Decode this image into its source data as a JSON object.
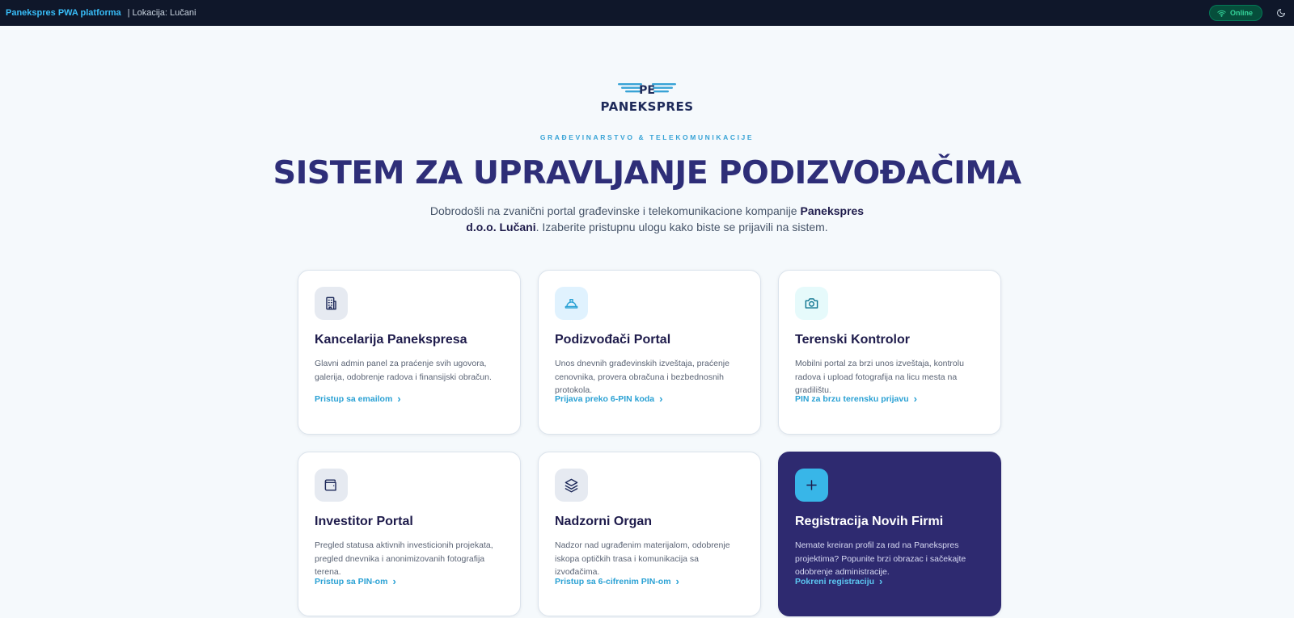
{
  "topbar": {
    "brand": "Panekspres PWA platforma",
    "location": "| Lokacija: Lučani",
    "status": "Online",
    "status_color": "#34d399"
  },
  "hero": {
    "logo_text": "PANEKSPRES",
    "tagline": "GRAĐEVINARSTVO & TELEKOMUNIKACIJE",
    "title": "SISTEM ZA UPRAVLJANJE PODIZVOĐAČIMA",
    "intro_pre": "Dobrodošli na zvanični portal građevinske i telekomunikacione kompanije ",
    "intro_bold": "Panekspres d.o.o. Lučani",
    "intro_post": ". Izaberite pristupnu ulogu kako biste se prijavili na sistem."
  },
  "cards": [
    {
      "icon": "building-icon",
      "title": "Kancelarija Panekspresa",
      "description": "Glavni admin panel za praćenje svih ugovora, galerija, odobrenje radova i finansijski obračun.",
      "link": "Pristup sa emailom"
    },
    {
      "icon": "hard-hat-icon",
      "title": "Podizvođači Portal",
      "description": "Unos dnevnih građevinskih izveštaja, praćenje cenovnika, provera obračuna i bezbednosnih protokola.",
      "link": "Prijava preko 6-PIN koda"
    },
    {
      "icon": "camera-icon",
      "title": "Terenski Kontrolor",
      "description": "Mobilni portal za brzi unos izveštaja, kontrolu radova i upload fotografija na licu mesta na gradilištu.",
      "link": "PIN za brzu terensku prijavu"
    },
    {
      "icon": "wallet-icon",
      "title": "Investitor Portal",
      "description": "Pregled statusa aktivnih investicionih projekata, pregled dnevnika i anonimizovanih fotografija terena.",
      "link": "Pristup sa PIN-om"
    },
    {
      "icon": "layers-icon",
      "title": "Nadzorni Organ",
      "description": "Nadzor nad ugrađenim materijalom, odobrenje iskopa optičkih trasa i komunikacija sa izvođačima.",
      "link": "Pristup sa 6-cifrenim PIN-om"
    },
    {
      "icon": "plus-icon",
      "title": "Registracija Novih Firmi",
      "description": "Nemate kreiran profil za rad na Panekspres projektima? Popunite brzi obrazac i sačekajte odobrenje administracije.",
      "link": "Pokreni registraciju"
    }
  ],
  "colors": {
    "accent": "#2aa1d4",
    "title": "#2e2e78",
    "dark_card": "#2e2a70"
  }
}
